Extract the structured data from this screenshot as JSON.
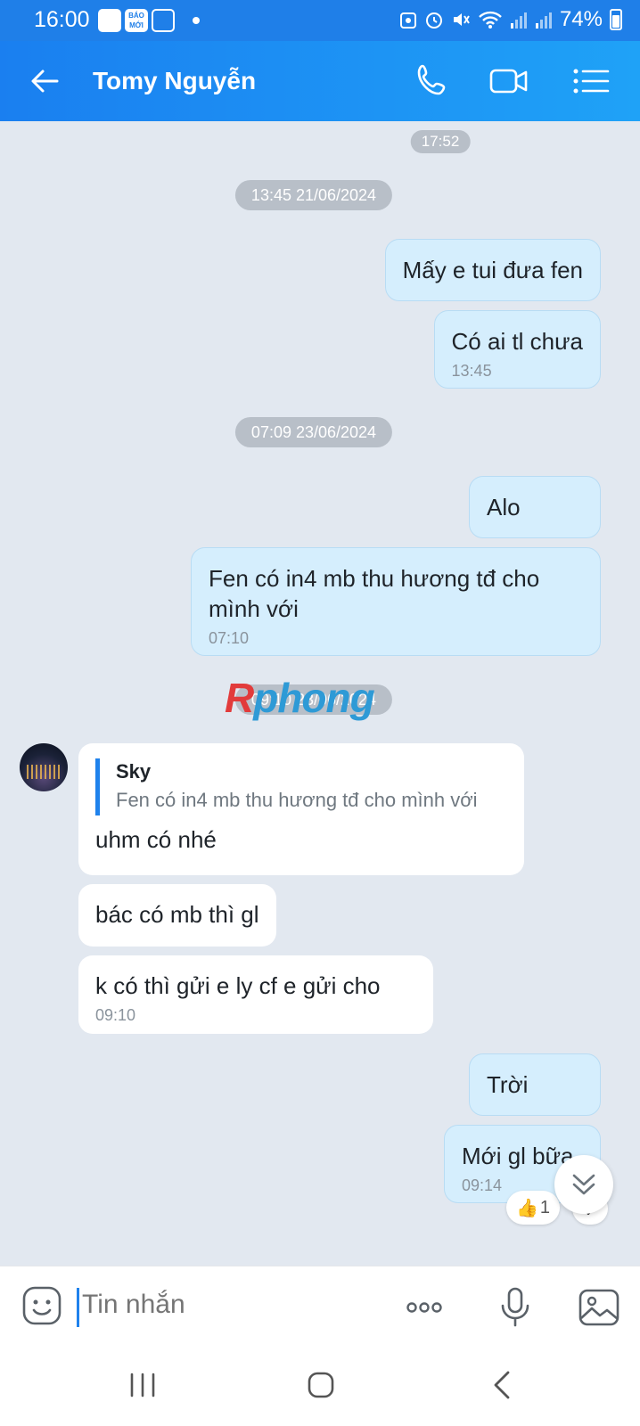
{
  "status_bar": {
    "time": "16:00",
    "app_icon_label": "BÁO MỚI",
    "battery": "74%"
  },
  "header": {
    "contact_name": "Tomy Nguyễn"
  },
  "chat": {
    "top_time": "17:52",
    "date_1": "13:45 21/06/2024",
    "date_2": "07:09 23/06/2024",
    "date_3": "09:10 23/06/2024",
    "watermark": [
      "R",
      "phong"
    ],
    "messages": [
      {
        "text": "Mấy e tui đưa fen",
        "time": ""
      },
      {
        "text": "Có ai tl chưa",
        "time": "13:45"
      },
      {
        "text": "Alo",
        "time": ""
      },
      {
        "text": "Fen có in4 mb thu hương tđ cho mình với",
        "time": "07:10"
      },
      {
        "text": "uhm có nhé",
        "time": "",
        "reply_name": "Sky",
        "reply_text": "Fen có in4 mb thu hương tđ cho mình với"
      },
      {
        "text": "bác có mb thì gl",
        "time": ""
      },
      {
        "text": "k có thì gửi e ly cf e gửi cho",
        "time": "09:10"
      },
      {
        "text": "Trời",
        "time": ""
      },
      {
        "text": "Mới gl bữa",
        "time": "09:14"
      }
    ],
    "reaction_count": "1"
  },
  "input": {
    "placeholder": "Tin nhắn"
  },
  "colors": {
    "header": "#1a7ff0",
    "bubble_out": "#d5eefd",
    "bubble_in": "#ffffff",
    "background": "#e2e8f0"
  },
  "icons": [
    "back-arrow-icon",
    "phone-icon",
    "video-call-icon",
    "menu-list-icon",
    "emoji-icon",
    "more-icon",
    "microphone-icon",
    "image-icon",
    "thumbs-up-icon",
    "check-icon",
    "double-chevron-down-icon"
  ]
}
